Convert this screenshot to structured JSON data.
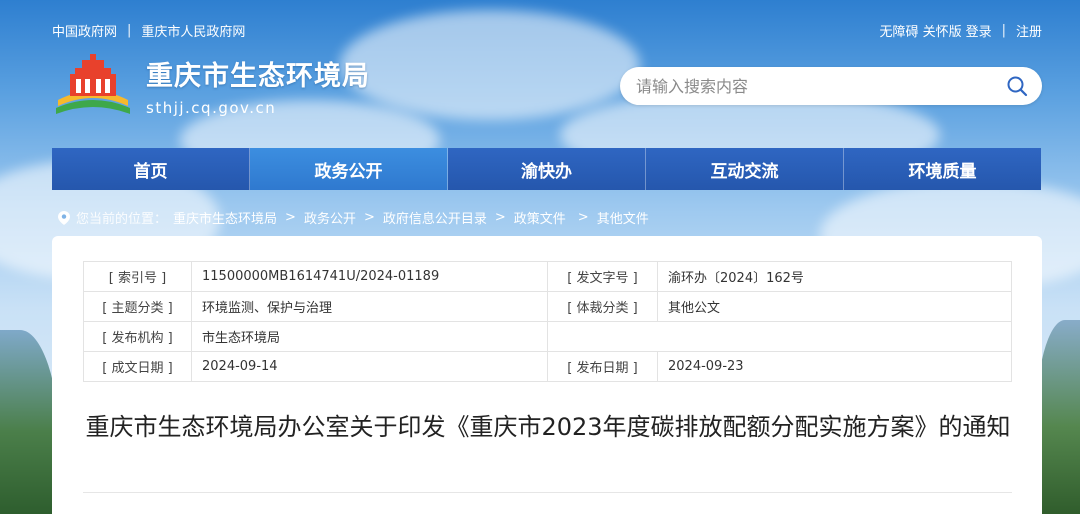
{
  "topbar": {
    "left_links": [
      "中国政府网",
      "重庆市人民政府网"
    ],
    "right_links": [
      "无障碍",
      "关怀版",
      "登录",
      "注册"
    ],
    "separator": "|"
  },
  "site": {
    "name": "重庆市生态环境局",
    "domain": "sthjj.cq.gov.cn"
  },
  "search": {
    "placeholder": "请输入搜索内容"
  },
  "nav": {
    "items": [
      {
        "label": "首页"
      },
      {
        "label": "政务公开"
      },
      {
        "label": "渝快办"
      },
      {
        "label": "互动交流"
      },
      {
        "label": "环境质量"
      }
    ],
    "active_index": 1
  },
  "breadcrumb": {
    "prefix": "您当前的位置：",
    "items": [
      "重庆市生态环境局",
      "政务公开",
      "政府信息公开目录",
      "政策文件",
      "其他文件"
    ],
    "separator": ">"
  },
  "meta": {
    "rows": [
      {
        "l1": "[ 索引号 ]",
        "v1": "11500000MB1614741U/2024-01189",
        "l2": "[ 发文字号 ]",
        "v2": "渝环办〔2024〕162号"
      },
      {
        "l1": "[ 主题分类 ]",
        "v1": "环境监测、保护与治理",
        "l2": "[ 体裁分类 ]",
        "v2": "其他公文"
      },
      {
        "l1": "[ 发布机构 ]",
        "v1": "市生态环境局",
        "l2": "",
        "v2": ""
      },
      {
        "l1": "[ 成文日期 ]",
        "v1": "2024-09-14",
        "l2": "[ 发布日期 ]",
        "v2": "2024-09-23"
      }
    ]
  },
  "document": {
    "title": "重庆市生态环境局办公室关于印发《重庆市2023年度碳排放配额分配实施方案》的通知"
  },
  "colors": {
    "nav_bg": "#2557ad",
    "nav_active": "#2f79cf",
    "text": "#333333"
  }
}
